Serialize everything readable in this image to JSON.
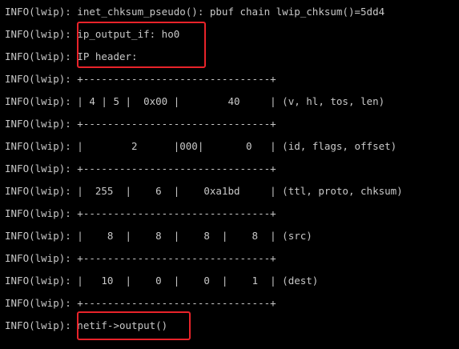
{
  "terminal": {
    "lines": [
      "INFO(lwip): inet_chksum_pseudo(): pbuf chain lwip_chksum()=5dd4",
      "INFO(lwip): ip_output_if: ho0",
      "INFO(lwip): IP header:",
      "INFO(lwip): +-------------------------------+",
      "INFO(lwip): | 4 | 5 |  0x00 |        40     | (v, hl, tos, len)",
      "INFO(lwip): +-------------------------------+",
      "INFO(lwip): |        2      |000|       0   | (id, flags, offset)",
      "INFO(lwip): +-------------------------------+",
      "INFO(lwip): |  255  |    6  |    0xa1bd     | (ttl, proto, chksum)",
      "INFO(lwip): +-------------------------------+",
      "INFO(lwip): |    8  |    8  |    8  |    8  | (src)",
      "INFO(lwip): +-------------------------------+",
      "INFO(lwip): |   10  |    0  |    0  |    1  | (dest)",
      "INFO(lwip): +-------------------------------+",
      "INFO(lwip): netif->output()"
    ]
  },
  "colors": {
    "background": "#000000",
    "text": "#c8c8c8",
    "highlight_border": "#e8232a"
  }
}
